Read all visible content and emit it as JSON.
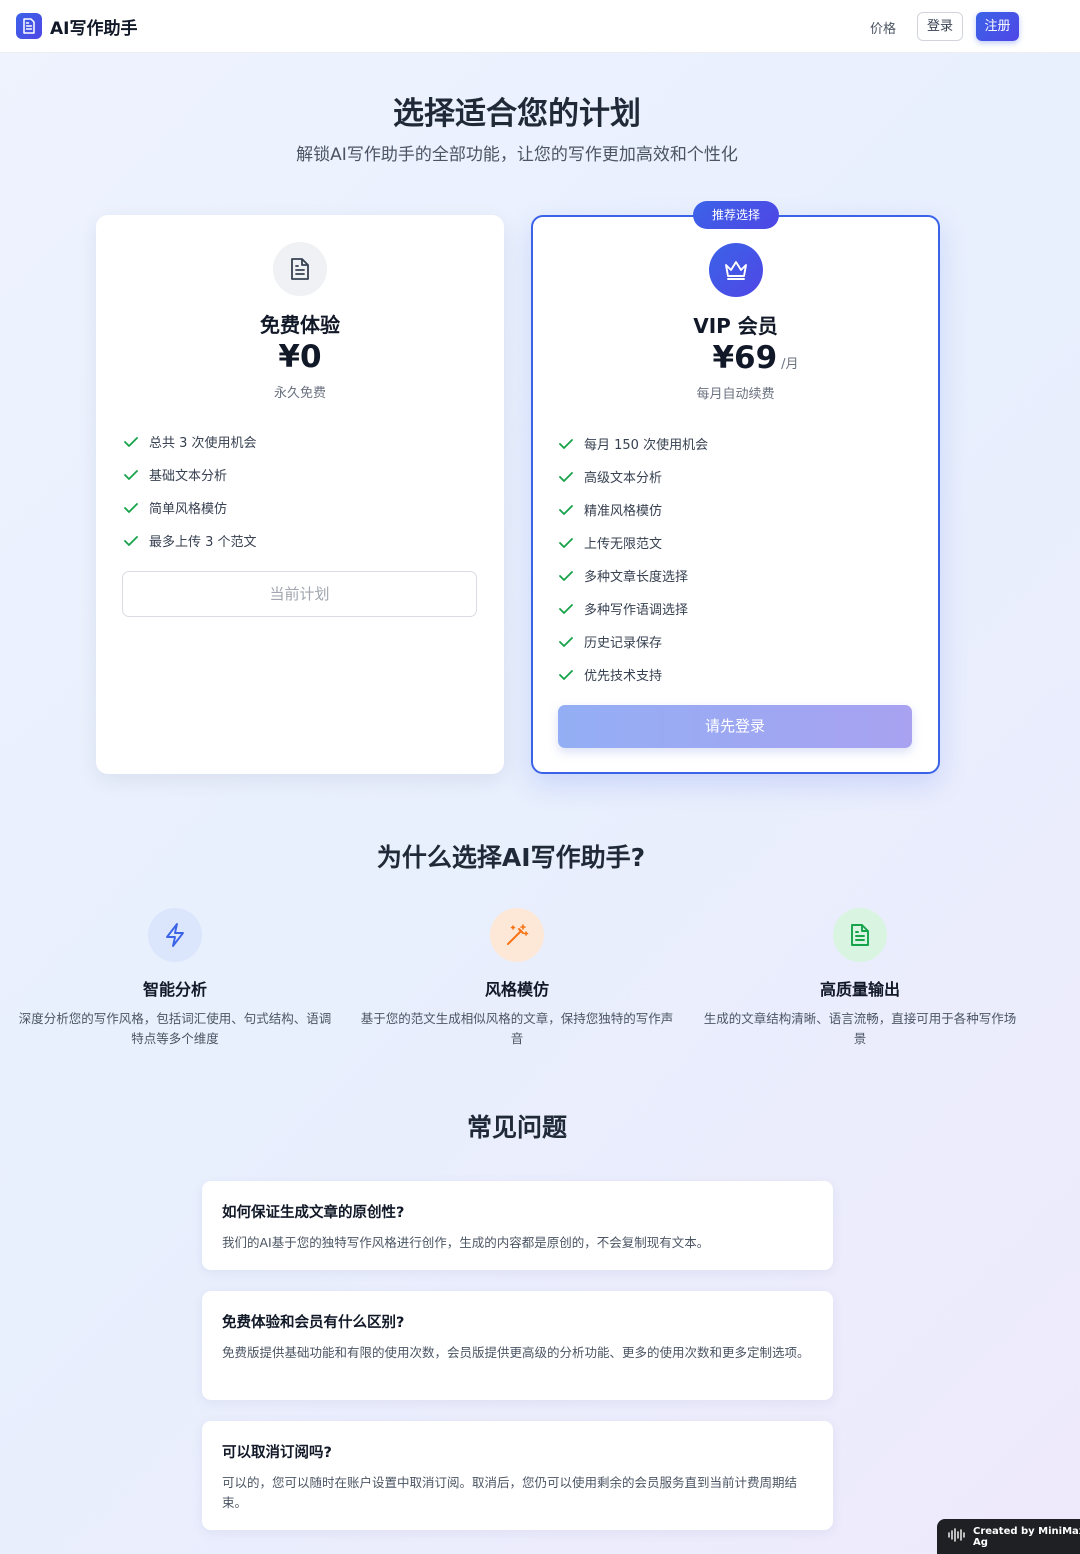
{
  "nav": {
    "brand": "AI写作助手",
    "price_link": "价格",
    "login": "登录",
    "register": "注册"
  },
  "hero": {
    "title": "选择适合您的计划",
    "subtitle": "解锁AI写作助手的全部功能，让您的写作更加高效和个性化"
  },
  "plans": {
    "free": {
      "icon": "document-icon",
      "name": "免费体验",
      "price": "¥0",
      "note": "永久免费",
      "features": [
        "总共 3 次使用机会",
        "基础文本分析",
        "简单风格模仿",
        "最多上传 3 个范文"
      ],
      "button": "当前计划"
    },
    "vip": {
      "badge": "推荐选择",
      "icon": "crown-icon",
      "name": "VIP 会员",
      "price": "¥69",
      "unit": "/月",
      "note": "每月自动续费",
      "features": [
        "每月 150 次使用机会",
        "高级文本分析",
        "精准风格模仿",
        "上传无限范文",
        "多种文章长度选择",
        "多种写作语调选择",
        "历史记录保存",
        "优先技术支持"
      ],
      "button": "请先登录"
    }
  },
  "why": {
    "title": "为什么选择AI写作助手?",
    "items": [
      {
        "icon": "lightning-icon",
        "name": "智能分析",
        "desc": "深度分析您的写作风格，包括词汇使用、句式结构、语调特点等多个维度",
        "color": "#3b63e8"
      },
      {
        "icon": "magic-wand-icon",
        "name": "风格模仿",
        "desc": "基于您的范文生成相似风格的文章，保持您独特的写作声音",
        "color": "#f97316"
      },
      {
        "icon": "document-icon",
        "name": "高质量输出",
        "desc": "生成的文章结构清晰、语言流畅，直接可用于各种写作场景",
        "color": "#16a34a"
      }
    ]
  },
  "faq": {
    "title": "常见问题",
    "items": [
      {
        "q": "如何保证生成文章的原创性?",
        "a": "我们的AI基于您的独特写作风格进行创作，生成的内容都是原创的，不会复制现有文本。"
      },
      {
        "q": "免费体验和会员有什么区别?",
        "a": "免费版提供基础功能和有限的使用次数，会员版提供更高级的分析功能、更多的使用次数和更多定制选项。"
      },
      {
        "q": "可以取消订阅吗?",
        "a": "可以的，您可以随时在账户设置中取消订阅。取消后，您仍可以使用剩余的会员服务直到当前计费周期结束。"
      }
    ]
  },
  "footer_badge": "Created by MiniMax Ag",
  "colors": {
    "accent": "#3b63e8",
    "accent2": "#4f46e5",
    "check": "#16a34a"
  }
}
